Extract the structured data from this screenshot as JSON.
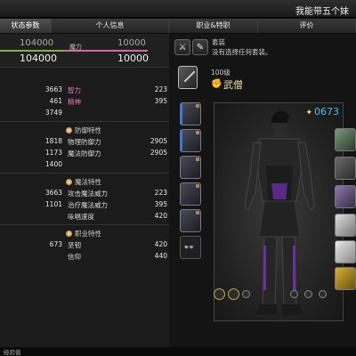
{
  "window": {
    "title": "我能带五个妹"
  },
  "tabs": [
    {
      "label": "状态参数",
      "active": true
    },
    {
      "label": "个人信息",
      "active": false
    },
    {
      "label": "职业&特职",
      "active": false
    },
    {
      "label": "评价",
      "active": false
    }
  ],
  "bars": {
    "hp_max": "104000",
    "hp_current": "104000",
    "mp_label": "魔力",
    "mp_max": "10000",
    "mp_current": "10000",
    "hp_fraction": 1.0,
    "mp_fraction": 1.0,
    "hp_color": "#7fb34a",
    "mp_color": "#d06aa0"
  },
  "attributes": {
    "left_values": [
      "3663",
      "461",
      "3749"
    ],
    "right": [
      {
        "label": "智力",
        "value": "223"
      },
      {
        "label": "精神",
        "value": "395"
      }
    ]
  },
  "defense": {
    "header": "防御特性",
    "left_values": [
      "1818",
      "1173",
      "1400"
    ],
    "rows": [
      {
        "label": "物理防御力",
        "value": "2905"
      },
      {
        "label": "魔法防御力",
        "value": "2905"
      }
    ]
  },
  "magic": {
    "header": "魔法特性",
    "left_values": [
      "3663",
      "1101"
    ],
    "rows": [
      {
        "label": "攻击魔法威力",
        "value": "223"
      },
      {
        "label": "治疗魔法威力",
        "value": "395"
      },
      {
        "label": "咏唱速度",
        "value": "420"
      }
    ]
  },
  "role": {
    "header": "职业特性",
    "left_values": [
      "673"
    ],
    "rows": [
      {
        "label": "坚韧",
        "value": "420"
      },
      {
        "label": "信仰",
        "value": "440"
      }
    ]
  },
  "gearset": {
    "title": "套装",
    "subtitle": "没有选择任何套装。"
  },
  "job": {
    "level": "100级",
    "name": "武僧",
    "item_level": "0673"
  },
  "footer": {
    "text": "经验值"
  }
}
